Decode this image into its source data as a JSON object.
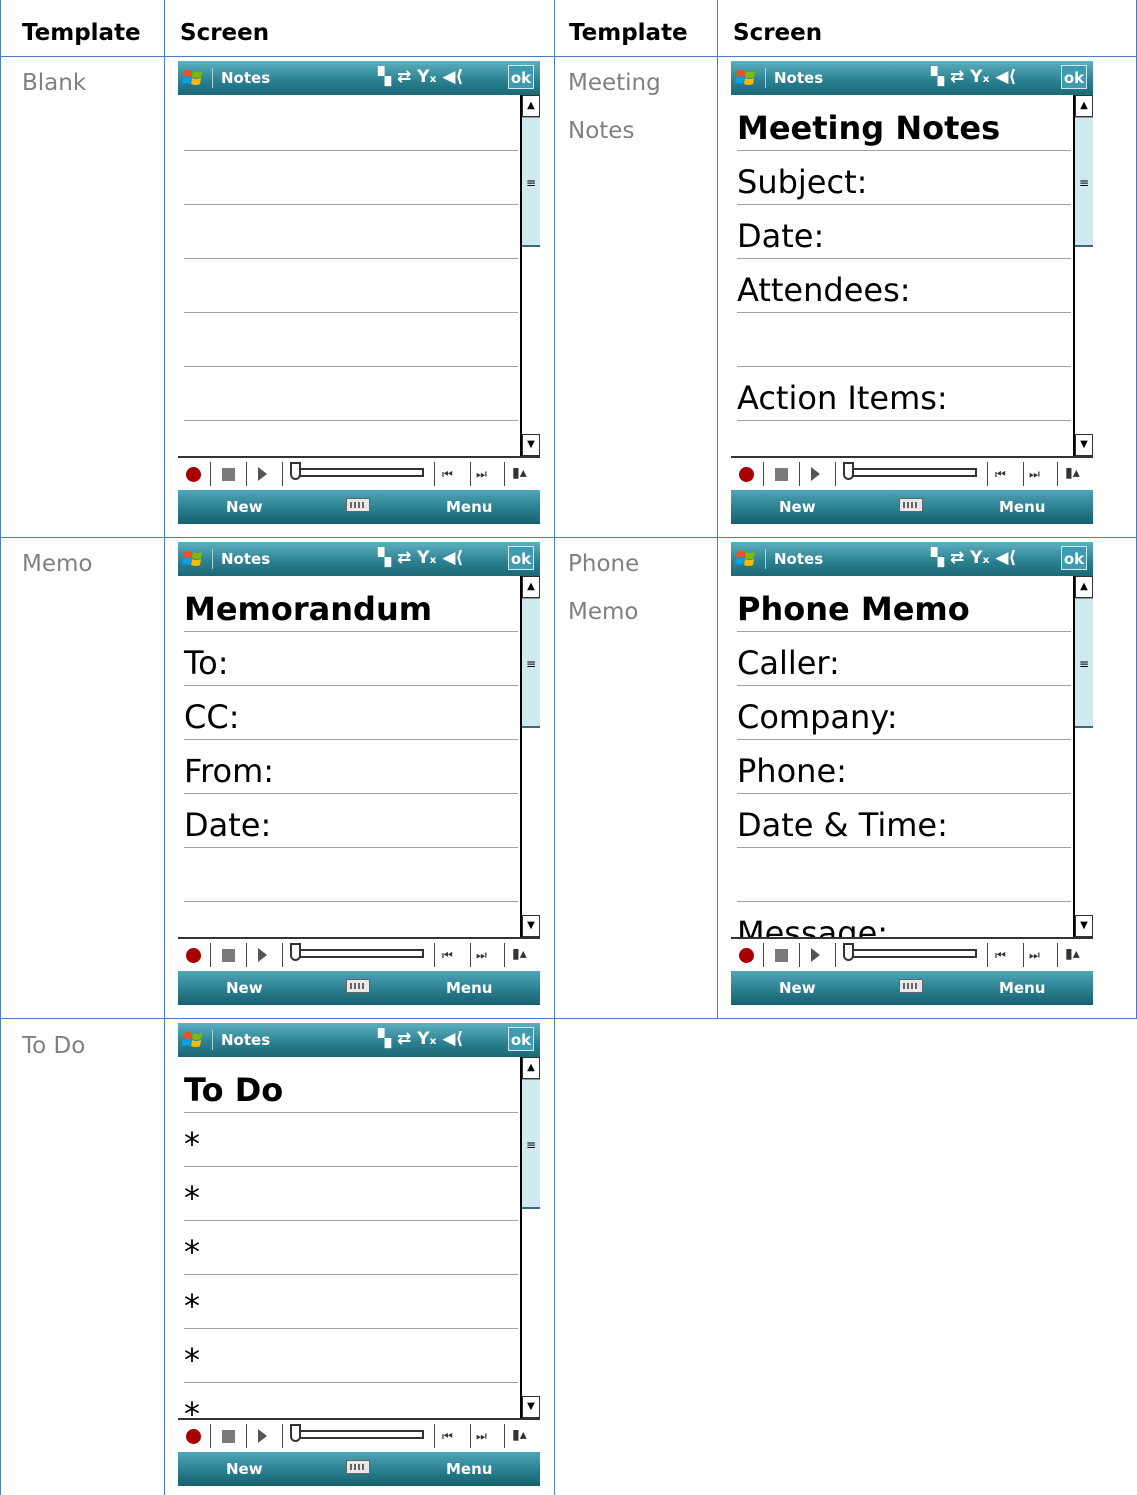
{
  "headers": {
    "template": "Template",
    "screen": "Screen"
  },
  "device": {
    "app_name": "Notes",
    "status_icons": "▚ ⇄ Yₓ ◀⟨",
    "ok_label": "ok",
    "soft_left": "New",
    "soft_right": "Menu"
  },
  "templates": [
    {
      "name": "Blank",
      "lines": []
    },
    {
      "name": "Meeting Notes",
      "lines": [
        "Meeting Notes",
        "Subject:",
        "Date:",
        "Attendees:",
        "",
        "Action Items:"
      ]
    },
    {
      "name": "Memo",
      "lines": [
        "Memorandum",
        "To:",
        "CC:",
        "From:",
        "Date:"
      ]
    },
    {
      "name": "Phone Memo",
      "lines": [
        "Phone Memo",
        "Caller:",
        "Company:",
        "Phone:",
        "Date & Time:",
        "",
        "Message:"
      ]
    },
    {
      "name": "To Do",
      "lines": [
        "To Do",
        "*",
        "*",
        "*",
        "*",
        "*",
        "*"
      ]
    }
  ]
}
